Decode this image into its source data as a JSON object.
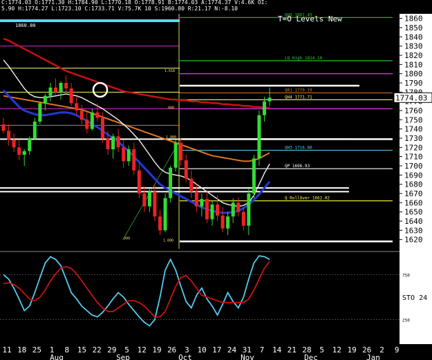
{
  "header": {
    "line1": "C:1774.03  O:1771.30  H:1784.90  L:1770.18  O:1778.91  B:1774.03  A:1774.37  V:4.6K  OI:",
    "line2": "5.90  H:1774.27  L:1723.10  C:1733.71  V:75.7K  10  S:1960.80  R:21.17  N:-8.10",
    "tag": "1860.80"
  },
  "chart_title": "T=O Levels New",
  "last_price_label": "1774.03",
  "colors": {
    "background": "#000000",
    "up_candle": "#33dd33",
    "down_candle": "#ee2222",
    "ma_red": "#cc1111",
    "ma_orange": "#e07820",
    "ma_blue": "#1f3bd8",
    "ma_white": "#e8e8e8",
    "sto_blue": "#55ccee",
    "sto_red": "#cc1111",
    "axis_panel": "#ffffff"
  },
  "levels": [
    {
      "label": "QHS 1861.45",
      "price": 1861,
      "color": "#33cc33"
    },
    {
      "label": "LQ High 1814.10",
      "price": 1814.1,
      "color": "#33cc33"
    },
    {
      "label": "QR1 1779.19",
      "price": 1779.19,
      "color": "#e07820"
    },
    {
      "label": "QH4 1771.71",
      "price": 1771.71,
      "color": "#ffff66"
    },
    {
      "label": "QH3 1716.86",
      "price": 1716.86,
      "color": "#55ccee"
    },
    {
      "label": "QP 1696.93",
      "price": 1696.93,
      "color": "#ffffff"
    },
    {
      "label": "Q RollOver 1662.02",
      "price": 1662.02,
      "color": "#ffff44"
    }
  ],
  "fib_labels": [
    "1.618",
    "1.000",
    ".000",
    "1.000",
    ".500",
    ".000"
  ],
  "chart_data": [
    {
      "type": "candlestick",
      "title": "T=O Levels New",
      "ylim": [
        1610,
        1865
      ],
      "yticks": [
        1620,
        1630,
        1640,
        1650,
        1660,
        1670,
        1680,
        1690,
        1700,
        1710,
        1720,
        1730,
        1740,
        1750,
        1760,
        1770,
        1780,
        1790,
        1800,
        1810,
        1820,
        1830,
        1840,
        1850,
        1860
      ],
      "last_price": 1774.03,
      "x_tick_labels": [
        "11",
        "18",
        "25",
        "1",
        "8",
        "15",
        "22",
        "29",
        "5",
        "12",
        "19",
        "26",
        "3",
        "10",
        "17",
        "24",
        "31",
        "7",
        "14",
        "21",
        "28",
        "5",
        "12",
        "19",
        "26",
        "2",
        "9"
      ],
      "x_month_labels": [
        "Aug",
        "Sep",
        "Oct",
        "Nov",
        "Dec",
        "Jan"
      ],
      "candles": [
        {
          "o": 1745,
          "h": 1752,
          "l": 1735,
          "c": 1738
        },
        {
          "o": 1738,
          "h": 1745,
          "l": 1722,
          "c": 1728
        },
        {
          "o": 1728,
          "h": 1735,
          "l": 1715,
          "c": 1720
        },
        {
          "o": 1720,
          "h": 1728,
          "l": 1706,
          "c": 1712
        },
        {
          "o": 1712,
          "h": 1718,
          "l": 1700,
          "c": 1716
        },
        {
          "o": 1716,
          "h": 1732,
          "l": 1712,
          "c": 1730
        },
        {
          "o": 1730,
          "h": 1752,
          "l": 1728,
          "c": 1748
        },
        {
          "o": 1748,
          "h": 1770,
          "l": 1745,
          "c": 1768
        },
        {
          "o": 1768,
          "h": 1778,
          "l": 1760,
          "c": 1776
        },
        {
          "o": 1776,
          "h": 1790,
          "l": 1770,
          "c": 1785
        },
        {
          "o": 1785,
          "h": 1795,
          "l": 1777,
          "c": 1780
        },
        {
          "o": 1780,
          "h": 1792,
          "l": 1772,
          "c": 1790
        },
        {
          "o": 1790,
          "h": 1798,
          "l": 1780,
          "c": 1784
        },
        {
          "o": 1784,
          "h": 1790,
          "l": 1765,
          "c": 1768
        },
        {
          "o": 1768,
          "h": 1775,
          "l": 1755,
          "c": 1760
        },
        {
          "o": 1760,
          "h": 1766,
          "l": 1745,
          "c": 1750
        },
        {
          "o": 1750,
          "h": 1758,
          "l": 1735,
          "c": 1740
        },
        {
          "o": 1740,
          "h": 1762,
          "l": 1738,
          "c": 1758
        },
        {
          "o": 1758,
          "h": 1768,
          "l": 1748,
          "c": 1752
        },
        {
          "o": 1752,
          "h": 1758,
          "l": 1725,
          "c": 1730
        },
        {
          "o": 1730,
          "h": 1738,
          "l": 1712,
          "c": 1718
        },
        {
          "o": 1718,
          "h": 1735,
          "l": 1708,
          "c": 1732
        },
        {
          "o": 1732,
          "h": 1740,
          "l": 1715,
          "c": 1720
        },
        {
          "o": 1720,
          "h": 1728,
          "l": 1698,
          "c": 1705
        },
        {
          "o": 1705,
          "h": 1722,
          "l": 1700,
          "c": 1718
        },
        {
          "o": 1718,
          "h": 1725,
          "l": 1690,
          "c": 1695
        },
        {
          "o": 1695,
          "h": 1702,
          "l": 1665,
          "c": 1670
        },
        {
          "o": 1670,
          "h": 1678,
          "l": 1650,
          "c": 1656
        },
        {
          "o": 1656,
          "h": 1675,
          "l": 1650,
          "c": 1672
        },
        {
          "o": 1672,
          "h": 1680,
          "l": 1640,
          "c": 1645
        },
        {
          "o": 1645,
          "h": 1652,
          "l": 1625,
          "c": 1630
        },
        {
          "o": 1630,
          "h": 1670,
          "l": 1628,
          "c": 1665
        },
        {
          "o": 1665,
          "h": 1700,
          "l": 1660,
          "c": 1698
        },
        {
          "o": 1698,
          "h": 1728,
          "l": 1694,
          "c": 1725
        },
        {
          "o": 1725,
          "h": 1730,
          "l": 1700,
          "c": 1706
        },
        {
          "o": 1706,
          "h": 1712,
          "l": 1682,
          "c": 1686
        },
        {
          "o": 1686,
          "h": 1695,
          "l": 1665,
          "c": 1672
        },
        {
          "o": 1672,
          "h": 1680,
          "l": 1650,
          "c": 1656
        },
        {
          "o": 1656,
          "h": 1670,
          "l": 1645,
          "c": 1664
        },
        {
          "o": 1664,
          "h": 1672,
          "l": 1638,
          "c": 1642
        },
        {
          "o": 1642,
          "h": 1662,
          "l": 1635,
          "c": 1658
        },
        {
          "o": 1658,
          "h": 1668,
          "l": 1640,
          "c": 1646
        },
        {
          "o": 1646,
          "h": 1655,
          "l": 1628,
          "c": 1632
        },
        {
          "o": 1632,
          "h": 1650,
          "l": 1625,
          "c": 1645
        },
        {
          "o": 1645,
          "h": 1665,
          "l": 1638,
          "c": 1660
        },
        {
          "o": 1660,
          "h": 1666,
          "l": 1645,
          "c": 1650
        },
        {
          "o": 1650,
          "h": 1655,
          "l": 1630,
          "c": 1635
        },
        {
          "o": 1635,
          "h": 1675,
          "l": 1625,
          "c": 1670
        },
        {
          "o": 1670,
          "h": 1712,
          "l": 1665,
          "c": 1708
        },
        {
          "o": 1708,
          "h": 1760,
          "l": 1700,
          "c": 1755
        },
        {
          "o": 1755,
          "h": 1775,
          "l": 1748,
          "c": 1770
        },
        {
          "o": 1770,
          "h": 1785,
          "l": 1765,
          "c": 1774
        }
      ],
      "moving_averages": [
        {
          "name": "red",
          "values": [
            1838,
            1836,
            1833,
            1830,
            1827,
            1824,
            1821,
            1818,
            1815,
            1812,
            1809,
            1806,
            1803,
            1801,
            1799,
            1797,
            1795,
            1793,
            1791,
            1789,
            1787,
            1785,
            1783,
            1781,
            1780,
            1779,
            1778,
            1777,
            1776,
            1775,
            1774,
            1773,
            1772,
            1772,
            1771,
            1771,
            1770,
            1770,
            1769,
            1769,
            1768,
            1768,
            1767,
            1767,
            1766,
            1766,
            1765,
            1765,
            1764,
            1764,
            1763,
            1763
          ]
        },
        {
          "name": "orange",
          "values": [
            1776,
            1775,
            1774,
            1773,
            1772,
            1771,
            1770,
            1769,
            1768,
            1767,
            1766,
            1765,
            1764,
            1763,
            1762,
            1761,
            1759,
            1757,
            1755,
            1753,
            1751,
            1749,
            1747,
            1745,
            1743,
            1741,
            1739,
            1737,
            1735,
            1733,
            1731,
            1729,
            1727,
            1725,
            1723,
            1721,
            1719,
            1717,
            1715,
            1713,
            1711,
            1710,
            1709,
            1708,
            1707,
            1706,
            1705,
            1705,
            1706,
            1708,
            1711,
            1714
          ]
        },
        {
          "name": "white",
          "values": [
            1815,
            1808,
            1800,
            1792,
            1784,
            1778,
            1775,
            1774,
            1774,
            1775,
            1776,
            1777,
            1778,
            1777,
            1776,
            1774,
            1771,
            1768,
            1765,
            1762,
            1758,
            1754,
            1750,
            1745,
            1740,
            1734,
            1728,
            1720,
            1712,
            1704,
            1697,
            1693,
            1691,
            1690,
            1689,
            1687,
            1684,
            1680,
            1676,
            1672,
            1668,
            1664,
            1660,
            1658,
            1657,
            1656,
            1657,
            1660,
            1668,
            1680,
            1692,
            1702
          ]
        },
        {
          "name": "blue",
          "values": [
            1782,
            1776,
            1770,
            1764,
            1760,
            1758,
            1756,
            1755,
            1755,
            1756,
            1757,
            1758,
            1758,
            1757,
            1755,
            1752,
            1749,
            1745,
            1742,
            1738,
            1734,
            1730,
            1726,
            1721,
            1716,
            1710,
            1704,
            1698,
            1692,
            1686,
            1680,
            1676,
            1673,
            1670,
            1667,
            1664,
            1661,
            1658,
            1655,
            1653,
            1651,
            1650,
            1649,
            1649,
            1650,
            1651,
            1654,
            1658,
            1663,
            1669,
            1676,
            1683
          ]
        }
      ],
      "stochastic": {
        "name": "STO 24",
        "ylim": [
          0,
          100
        ],
        "levels": [
          25,
          75
        ],
        "k": [
          75,
          70,
          60,
          48,
          35,
          40,
          55,
          72,
          88,
          95,
          92,
          85,
          70,
          55,
          48,
          40,
          35,
          30,
          28,
          33,
          40,
          48,
          55,
          50,
          42,
          35,
          28,
          22,
          18,
          25,
          50,
          80,
          92,
          80,
          62,
          45,
          38,
          52,
          60,
          48,
          40,
          30,
          42,
          55,
          45,
          38,
          50,
          70,
          88,
          96,
          95,
          92
        ],
        "d": [
          65,
          66,
          64,
          60,
          54,
          48,
          46,
          50,
          58,
          68,
          76,
          82,
          84,
          82,
          76,
          68,
          60,
          52,
          44,
          38,
          34,
          34,
          38,
          42,
          46,
          46,
          44,
          40,
          34,
          28,
          28,
          34,
          48,
          62,
          72,
          74,
          68,
          60,
          52,
          50,
          48,
          46,
          44,
          44,
          44,
          44,
          44,
          48,
          58,
          70,
          82,
          90
        ]
      }
    }
  ]
}
